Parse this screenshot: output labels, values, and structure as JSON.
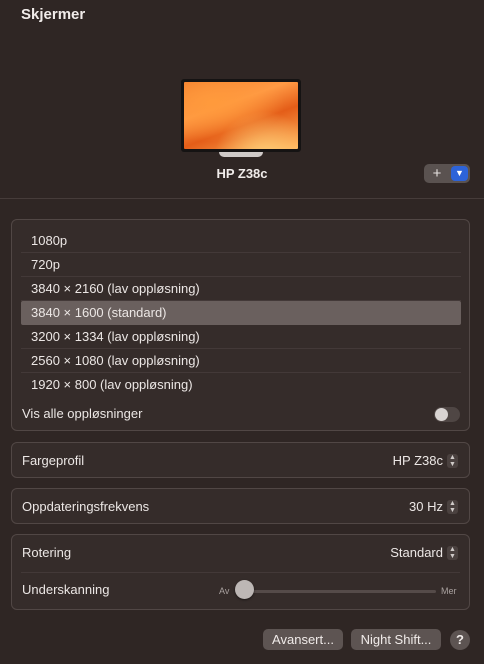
{
  "header": {
    "title": "Skjermer"
  },
  "display": {
    "name": "HP Z38c",
    "add_label": "+",
    "menu_icon": "chevron-down-icon"
  },
  "resolutions": {
    "items": [
      {
        "label": "1080p",
        "selected": false
      },
      {
        "label": "720p",
        "selected": false
      },
      {
        "label": "3840 × 2160 (lav oppløsning)",
        "selected": false
      },
      {
        "label": "3840 × 1600 (standard)",
        "selected": true
      },
      {
        "label": "3200 × 1334 (lav oppløsning)",
        "selected": false
      },
      {
        "label": "2560 × 1080 (lav oppløsning)",
        "selected": false
      },
      {
        "label": "1920 × 800 (lav oppløsning)",
        "selected": false
      }
    ],
    "show_all_label": "Vis alle oppløsninger",
    "show_all_on": false
  },
  "color_profile": {
    "label": "Fargeprofil",
    "value": "HP Z38c"
  },
  "refresh_rate": {
    "label": "Oppdateringsfrekvens",
    "value": "30 Hz"
  },
  "rotation": {
    "label": "Rotering",
    "value": "Standard"
  },
  "underscan": {
    "label": "Underskanning",
    "min_label": "Av",
    "max_label": "Mer",
    "level": 0
  },
  "footer": {
    "advanced_label": "Avansert...",
    "night_shift_label": "Night Shift...",
    "help_label": "?"
  },
  "colors": {
    "background": "#2f2624",
    "selected_row": "#6a605e",
    "accent": "#2d63d8"
  }
}
